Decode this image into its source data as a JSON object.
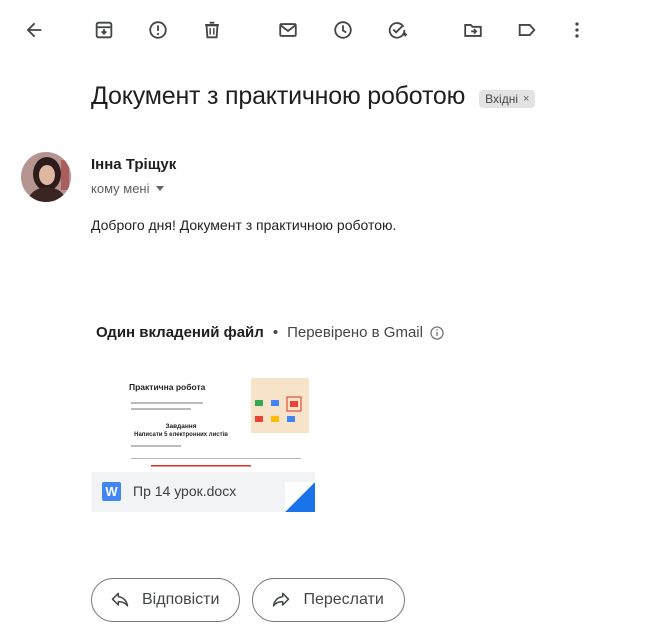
{
  "toolbar": {
    "icons": [
      "back-arrow-icon",
      "archive-icon",
      "report-spam-icon",
      "delete-icon",
      "mark-unread-icon",
      "snooze-icon",
      "add-task-icon",
      "move-to-icon",
      "label-icon",
      "more-options-icon"
    ]
  },
  "email": {
    "subject": "Документ з практичною роботою",
    "label": "Вхідні",
    "label_close": "×",
    "sender_name": "Інна Тріщук",
    "recipient": "кому мені",
    "body": "Доброго дня! Документ з практичною роботою."
  },
  "attachments": {
    "count_text": "Один вкладений файл",
    "separator": "•",
    "verified_text": "Перевірено в Gmail",
    "file": {
      "name": "Пр 14 урок.docx",
      "type_letter": "W",
      "preview_title": "Практична робота",
      "preview_heading1": "Завдання",
      "preview_heading2": "Написати 5 електронних листів"
    }
  },
  "actions": {
    "reply": "Відповісти",
    "forward": "Переслати"
  },
  "colors": {
    "word_blue": "#4285f4",
    "chip_bg": "#e3e3e3",
    "attachment_bar": "#f1f3f4"
  }
}
